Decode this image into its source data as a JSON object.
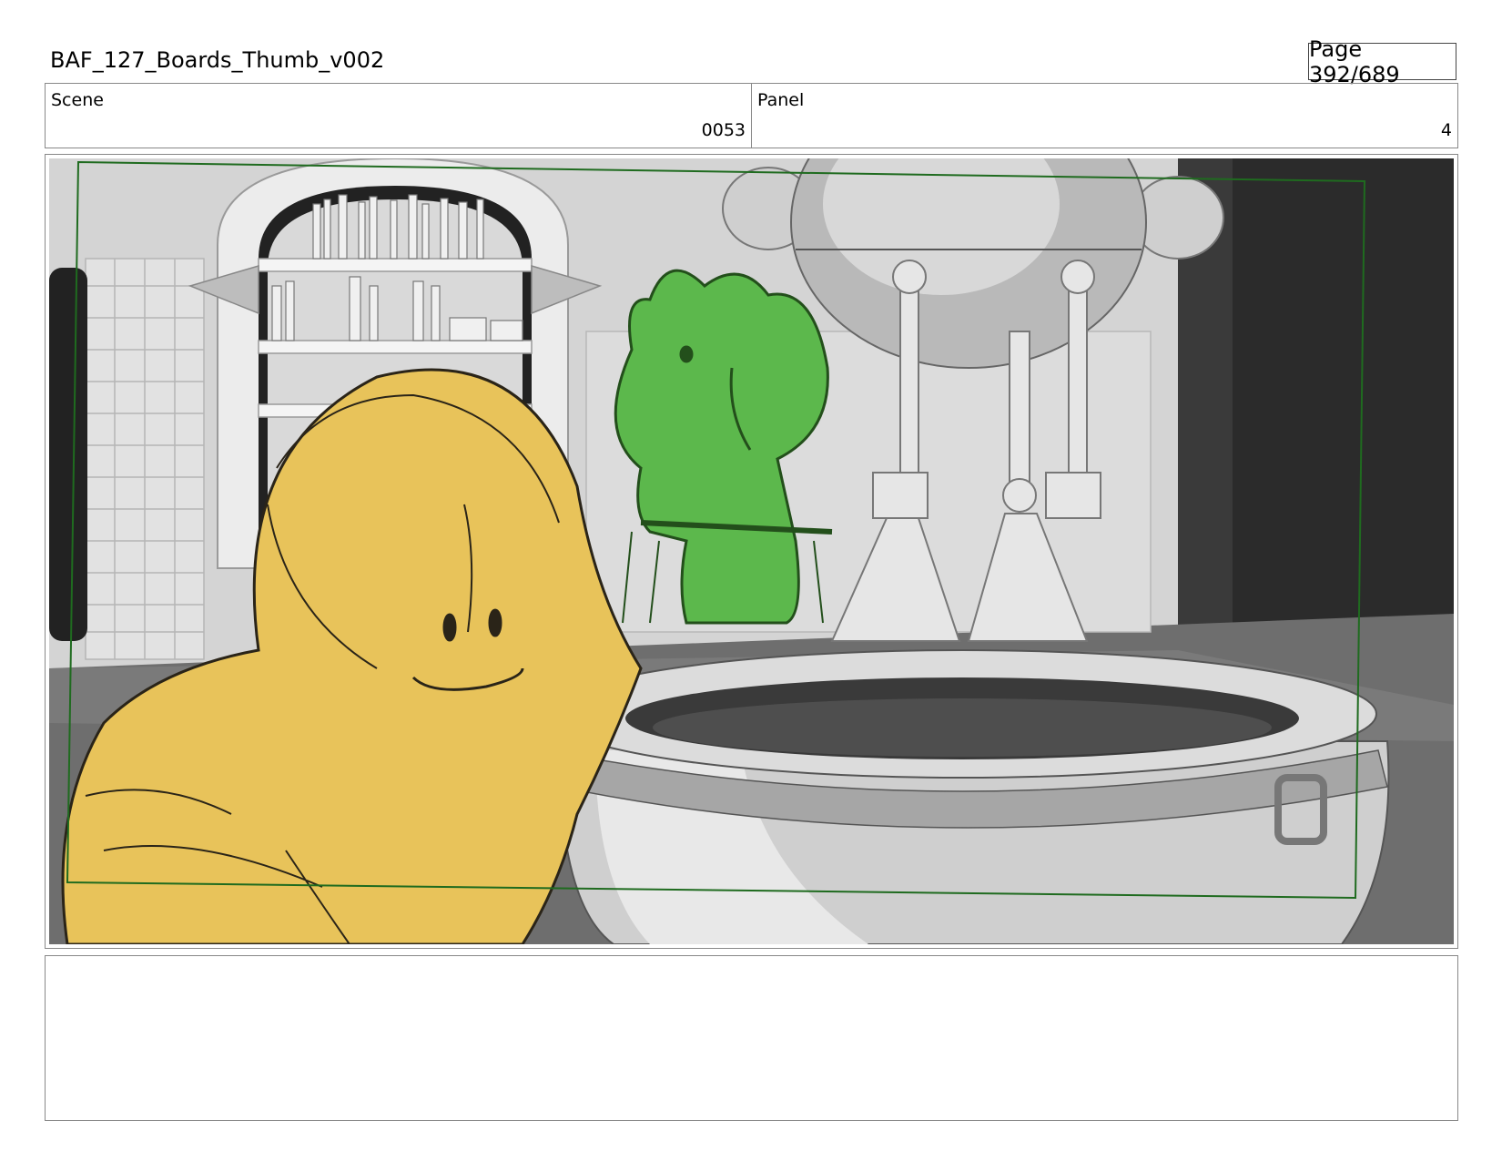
{
  "document": {
    "title": "BAF_127_Boards_Thumb_v002",
    "page_label": "Page 392/689"
  },
  "info": {
    "scene_label": "Scene",
    "scene_value": "0053",
    "panel_label": "Panel",
    "panel_value": "4"
  },
  "panel_image": {
    "description_icon": "storyboard-panel-image",
    "frame_color": "#1f6b1f",
    "character_yellow": "#e8c35a",
    "character_green": "#5cb84c"
  },
  "notes": {
    "text": ""
  }
}
